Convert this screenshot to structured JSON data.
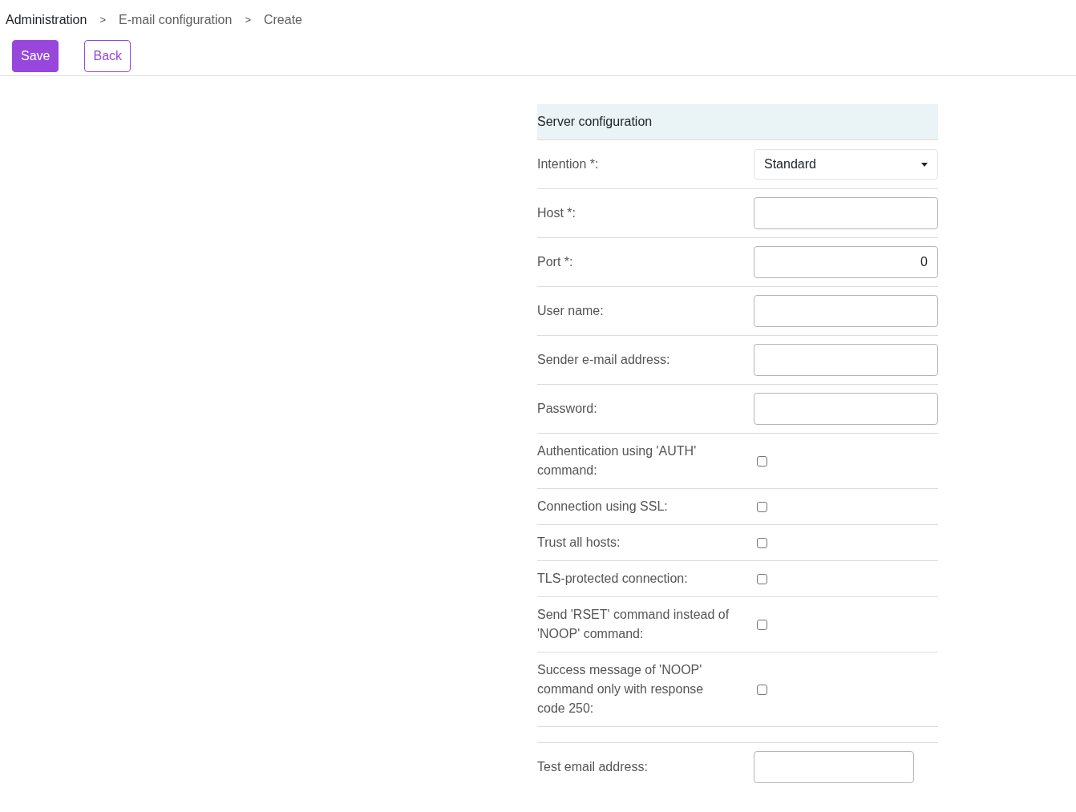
{
  "breadcrumb": [
    {
      "label": "Administration"
    },
    {
      "label": "E-mail configuration"
    },
    {
      "label": "Create"
    }
  ],
  "breadcrumb_separator": ">",
  "buttons": [
    {
      "label": "Save",
      "kind": "primary"
    },
    {
      "label": "Back",
      "kind": "outline"
    }
  ],
  "section": {
    "title": "Server configuration"
  },
  "fields": [
    {
      "kind": "select",
      "label": "Intention *:",
      "value": "Standard"
    },
    {
      "kind": "text",
      "label": "Host *:"
    },
    {
      "kind": "number",
      "label": "Port *:",
      "value": "0"
    },
    {
      "kind": "text",
      "label": "User name:"
    },
    {
      "kind": "text",
      "label": "Sender e-mail address:"
    },
    {
      "kind": "text",
      "label": "Password:"
    },
    {
      "kind": "checkbox",
      "label": "Authentication using 'AUTH' command:",
      "checked": false
    },
    {
      "kind": "checkbox",
      "label": "Connection using SSL:",
      "checked": false
    },
    {
      "kind": "checkbox",
      "label": "Trust all hosts:",
      "checked": false
    },
    {
      "kind": "checkbox",
      "label": "TLS-protected connection:",
      "checked": false
    },
    {
      "kind": "checkbox",
      "label": "Send 'RSET' command instead of 'NOOP' command:",
      "checked": false
    },
    {
      "kind": "checkbox",
      "label": "Success message of 'NOOP' command only with response code 250:",
      "checked": false
    }
  ],
  "test": {
    "label": "Test email address:"
  }
}
